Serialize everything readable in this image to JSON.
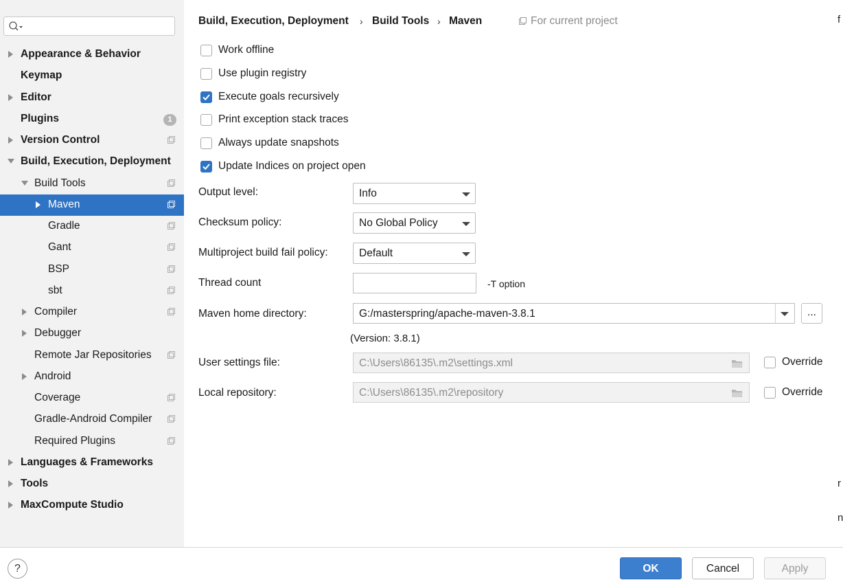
{
  "sidebar": {
    "search": {
      "value": "",
      "placeholder": ""
    },
    "items": [
      {
        "label": "Appearance & Behavior",
        "arrow": "right"
      },
      {
        "label": "Keymap"
      },
      {
        "label": "Editor",
        "arrow": "right"
      },
      {
        "label": "Plugins",
        "badge": "1"
      },
      {
        "label": "Version Control",
        "arrow": "right"
      },
      {
        "label": "Build, Execution, Deployment",
        "arrow": "down"
      },
      {
        "label": "Build Tools",
        "arrow": "down"
      },
      {
        "label": "Maven",
        "arrow": "right",
        "selected": true
      },
      {
        "label": "Gradle"
      },
      {
        "label": "Gant"
      },
      {
        "label": "BSP"
      },
      {
        "label": "sbt"
      },
      {
        "label": "Compiler",
        "arrow": "right"
      },
      {
        "label": "Debugger",
        "arrow": "right"
      },
      {
        "label": "Remote Jar Repositories"
      },
      {
        "label": "Android",
        "arrow": "right"
      },
      {
        "label": "Coverage"
      },
      {
        "label": "Gradle-Android Compiler"
      },
      {
        "label": "Required Plugins"
      },
      {
        "label": "Languages & Frameworks",
        "arrow": "right"
      },
      {
        "label": "Tools",
        "arrow": "right"
      },
      {
        "label": "MaxCompute Studio",
        "arrow": "right"
      }
    ]
  },
  "breadcrumb": {
    "items": [
      "Build, Execution, Deployment",
      "Build Tools",
      "Maven"
    ],
    "scope": "For current project"
  },
  "options": [
    {
      "label": "Work offline",
      "checked": false
    },
    {
      "label": "Use plugin registry",
      "checked": false
    },
    {
      "label": "Execute goals recursively",
      "checked": true
    },
    {
      "label": "Print exception stack traces",
      "checked": false
    },
    {
      "label": "Always update snapshots",
      "checked": false
    },
    {
      "label": "Update Indices on project open",
      "checked": true
    }
  ],
  "form": {
    "output_level": {
      "label": "Output level:",
      "value": "Info"
    },
    "checksum_policy": {
      "label": "Checksum policy:",
      "value": "No Global Policy"
    },
    "fail_policy": {
      "label": "Multiproject build fail policy:",
      "value": "Default"
    },
    "thread_count": {
      "label": "Thread count",
      "value": "",
      "hint": "-T option"
    },
    "maven_home": {
      "label": "Maven home directory:",
      "value": "G:/masterspring/apache-maven-3.8.1",
      "browse": "...",
      "version": "(Version: 3.8.1)"
    },
    "user_settings": {
      "label": "User settings file:",
      "value": "C:\\Users\\86135\\.m2\\settings.xml",
      "override_label": "Override",
      "override": false
    },
    "local_repo": {
      "label": "Local repository:",
      "value": "C:\\Users\\86135\\.m2\\repository",
      "override_label": "Override",
      "override": false
    }
  },
  "footer": {
    "help": "?",
    "ok": "OK",
    "cancel": "Cancel",
    "apply": "Apply"
  },
  "edge": {
    "top": "f",
    "mid": "r",
    "low": "n"
  },
  "colors": {
    "accent": "#2f73c4",
    "sidebar_bg": "#f2f2f2"
  }
}
